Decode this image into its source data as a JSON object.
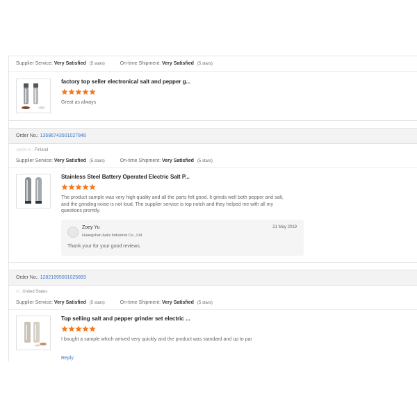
{
  "reviews": [
    {
      "order_label": "",
      "order_number": "",
      "buyer_name": "",
      "buyer_country": "",
      "supplier_service_label": "Supplier Service:",
      "supplier_service_value": "Very Satisfied",
      "supplier_service_stars": "(5 stars)",
      "shipment_label": "On-time Shipment:",
      "shipment_value": "Very Satisfied",
      "shipment_stars": "(5 stars)",
      "product_title": "factory top seller electronical salt and pepper g...",
      "rating": 5,
      "review_text": "Great as always"
    },
    {
      "order_label": "Order No.:",
      "order_number": "13586743501027848",
      "buyer_name": "Jason K...",
      "buyer_country": "Finland",
      "supplier_service_label": "Supplier Service:",
      "supplier_service_value": "Very Satisfied",
      "supplier_service_stars": "(5 stars)",
      "shipment_label": "On-time Shipment:",
      "shipment_value": "Very Satisfied",
      "shipment_stars": "(5 stars)",
      "product_title": "Stainless Steel Battery Operated Electric Salt P...",
      "rating": 5,
      "review_text": "The product sample was very high quality and all the parts felt good. It grinds well both pepper and salt, and the grinding noise is not loud. The supplier service is top notch and they helped me with all my questions promtly.",
      "reply": {
        "name": "Zoey Yu",
        "company": "Huangshan Auliz Industrial Co., Ltd.",
        "date": "21 May 2019",
        "text": "Thank your for your good reviews."
      }
    },
    {
      "order_label": "Order No.:",
      "order_number": "12821995001025893",
      "buyer_name": "R...",
      "buyer_country": "United States",
      "supplier_service_label": "Supplier Service:",
      "supplier_service_value": "Very Satisfied",
      "supplier_service_stars": "(5 stars)",
      "shipment_label": "On-time Shipment:",
      "shipment_value": "Very Satisfied",
      "shipment_stars": "(5 stars)",
      "product_title": "Top selling salt and pepper grinder set electric ...",
      "rating": 5,
      "review_text": "I bought a sample which arrived very quickly and the product was standard and up to par",
      "reply_link": "Reply"
    }
  ],
  "colors": {
    "star": "#f47b20",
    "link": "#3b78c2",
    "header_bg": "#f3f3f3"
  }
}
